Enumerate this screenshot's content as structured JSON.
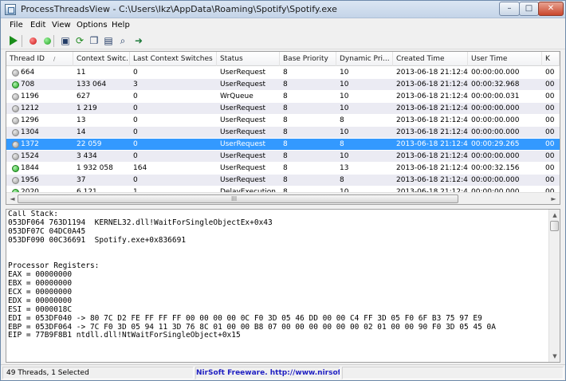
{
  "window": {
    "title": "ProcessThreadsView -  C:\\Users\\Ikz\\AppData\\Roaming\\Spotify\\Spotify.exe",
    "controls": {
      "minimize": "–",
      "maximize": "□",
      "close": "✕"
    }
  },
  "menu": [
    "File",
    "Edit",
    "View",
    "Options",
    "Help"
  ],
  "toolbar": {
    "icons": [
      "play-icon",
      "stop-red-icon",
      "resume-green-icon",
      "save-icon",
      "refresh-icon",
      "copy-icon",
      "properties-icon",
      "find-icon",
      "exit-icon"
    ],
    "glyphs": {
      "save": "▣",
      "refresh": "⟳",
      "copy": "❐",
      "properties": "▤",
      "find": "⌕",
      "exit": "➜"
    }
  },
  "table": {
    "sort_arrow": "/",
    "columns": [
      "Thread ID",
      "Context Switc...",
      "Last Context Switches",
      "Status",
      "Base Priority",
      "Dynamic Pri...",
      "Created Time",
      "User Time",
      "K"
    ],
    "rows": [
      {
        "status_color": "gray",
        "cells": [
          "664",
          "11",
          "0",
          "UserRequest",
          "8",
          "10",
          "2013-06-18 21:12:41",
          "00:00:00.000",
          "00"
        ]
      },
      {
        "status_color": "green",
        "cells": [
          "708",
          "133 064",
          "3",
          "UserRequest",
          "8",
          "10",
          "2013-06-18 21:12:42",
          "00:00:32.968",
          "00"
        ]
      },
      {
        "status_color": "gray",
        "cells": [
          "1196",
          "627",
          "0",
          "WrQueue",
          "8",
          "10",
          "2013-06-18 21:12:43",
          "00:00:00.031",
          "00"
        ]
      },
      {
        "status_color": "gray",
        "cells": [
          "1212",
          "1 219",
          "0",
          "UserRequest",
          "8",
          "10",
          "2013-06-18 21:12:44",
          "00:00:00.000",
          "00"
        ]
      },
      {
        "status_color": "gray",
        "cells": [
          "1296",
          "13",
          "0",
          "UserRequest",
          "8",
          "8",
          "2013-06-18 21:12:41",
          "00:00:00.000",
          "00"
        ]
      },
      {
        "status_color": "gray",
        "cells": [
          "1304",
          "14",
          "0",
          "UserRequest",
          "8",
          "10",
          "2013-06-18 21:12:41",
          "00:00:00.000",
          "00"
        ]
      },
      {
        "status_color": "gray",
        "selected": true,
        "cells": [
          "1372",
          "22 059",
          "0",
          "UserRequest",
          "8",
          "8",
          "2013-06-18 21:12:42",
          "00:00:29.265",
          "00"
        ]
      },
      {
        "status_color": "gray",
        "cells": [
          "1524",
          "3 434",
          "0",
          "UserRequest",
          "8",
          "10",
          "2013-06-18 21:12:42",
          "00:00:00.000",
          "00"
        ]
      },
      {
        "status_color": "green",
        "cells": [
          "1844",
          "1 932 058",
          "164",
          "UserRequest",
          "8",
          "13",
          "2013-06-18 21:12:40",
          "00:00:32.156",
          "00"
        ]
      },
      {
        "status_color": "gray",
        "cells": [
          "1956",
          "37",
          "0",
          "UserRequest",
          "8",
          "8",
          "2013-06-18 21:12:42",
          "00:00:00.000",
          "00"
        ]
      },
      {
        "status_color": "green",
        "cells": [
          "2020",
          "6 121",
          "1",
          "DelayExecution",
          "8",
          "10",
          "2013-06-18 21:12:41",
          "00:00:00.000",
          "00"
        ]
      }
    ]
  },
  "scroll": {
    "left": "◄",
    "right": "►",
    "up": "▲",
    "down": "▼",
    "grip": "III"
  },
  "details": {
    "lines": [
      "Call Stack:",
      "053DF064 763D1194  KERNEL32.dll!WaitForSingleObjectEx+0x43",
      "053DF07C 04DC0A45",
      "053DF090 00C36691  Spotify.exe+0x836691",
      "",
      "",
      "Processor Registers:",
      "EAX = 00000000",
      "EBX = 00000000",
      "ECX = 00000000",
      "EDX = 00000000",
      "ESI = 0000018C",
      "EDI = 053DF040 -> 80 7C D2 FE FF FF FF 00 00 00 00 0C F0 3D 05 46 DD 00 00 C4 FF 3D 05 F0 6F B3 75 97 E9",
      "EBP = 053DF064 -> 7C F0 3D 05 94 11 3D 76 8C 01 00 00 B8 07 00 00 00 00 00 00 02 01 00 00 90 F0 3D 05 45 0A",
      "EIP = 77B9F8B1 ntdll.dll!NtWaitForSingleObject+0x15"
    ]
  },
  "statusbar": {
    "count": "49 Threads, 1 Selected",
    "link": "NirSoft Freeware.  http://www.nirsoft.net"
  }
}
